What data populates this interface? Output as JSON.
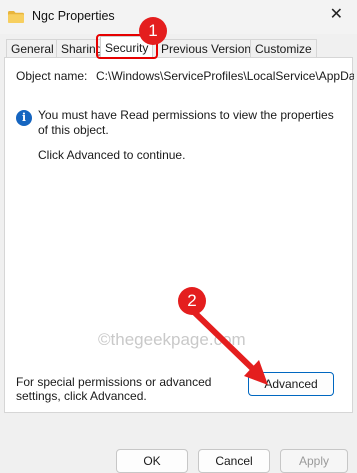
{
  "window": {
    "title": "Ngc Properties",
    "folder_icon": "folder-icon",
    "close_icon": "close-icon",
    "close_glyph": "✕"
  },
  "tabs": [
    {
      "label": "General",
      "active": false
    },
    {
      "label": "Sharing",
      "active": false
    },
    {
      "label": "Security",
      "active": true
    },
    {
      "label": "Previous Versions",
      "active": false
    },
    {
      "label": "Customize",
      "active": false
    }
  ],
  "security": {
    "object_name_label": "Object name:",
    "object_name_value": "C:\\Windows\\ServiceProfiles\\LocalService\\AppDat",
    "info_icon": "info-icon",
    "info_glyph": "i",
    "info_message": "You must have Read permissions to view the properties of this object.",
    "advanced_message": "Click Advanced to continue.",
    "special_permissions_text": "For special permissions or advanced settings, click Advanced.",
    "advanced_button": "Advanced"
  },
  "watermark": "©thegeekpage.com",
  "footer": {
    "ok": "OK",
    "cancel": "Cancel",
    "apply": "Apply",
    "apply_disabled": true
  },
  "annotations": {
    "badge_1": "1",
    "badge_2": "2",
    "color": "#e41e1e"
  }
}
